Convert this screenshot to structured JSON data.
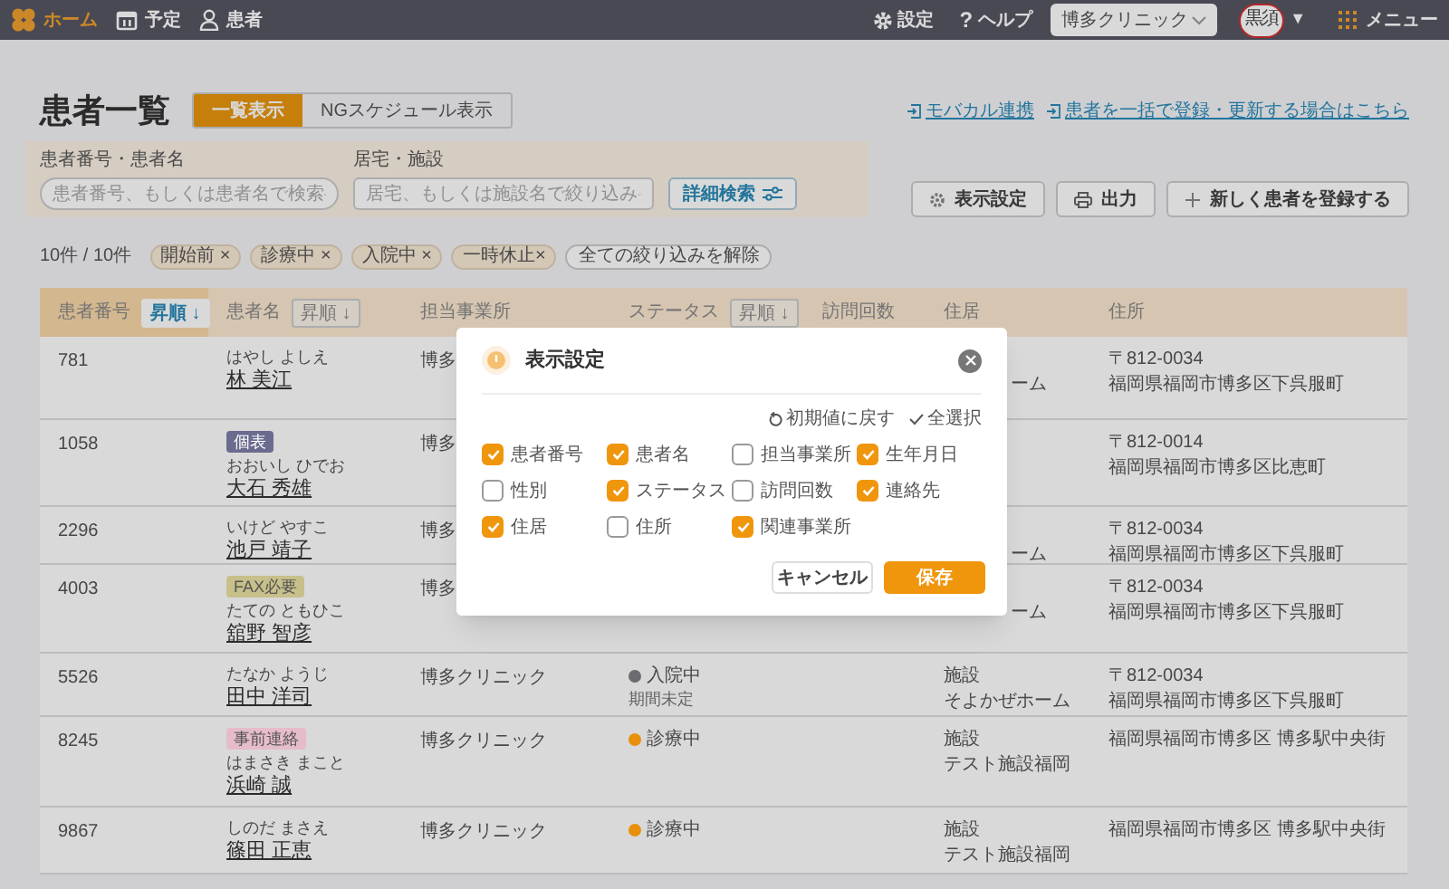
{
  "nav": {
    "items": [
      {
        "label": "ホーム",
        "kind": "home",
        "selected": true
      },
      {
        "label": "予定",
        "kind": "calendar",
        "selected": false
      },
      {
        "label": "患者",
        "kind": "person",
        "selected": false
      }
    ],
    "settings": "設定",
    "help_icon": "?",
    "help": "ヘルプ",
    "clinic_select": "博多クリニック",
    "avatar": "黒須",
    "avatar_caret": "▼",
    "menu": "メニュー"
  },
  "page": {
    "title": "患者一覧",
    "view_tabs": [
      {
        "label": "一覧表示",
        "selected": true
      },
      {
        "label": "NGスケジュール表示",
        "selected": false
      }
    ],
    "links": [
      "モバカル連携",
      "患者を一括で登録・更新する場合はこちら"
    ],
    "search": {
      "label": "患者番号・患者名",
      "placeholder": "患者番号、もしくは患者名で検索"
    },
    "facility": {
      "label": "居宅・施設",
      "placeholder": "居宅、もしくは施設名で絞り込み"
    },
    "advanced_search": "詳細検索",
    "actions": [
      {
        "label": "表示設定",
        "kind": "gear"
      },
      {
        "label": "出力",
        "kind": "printer"
      },
      {
        "label": "新しく患者を登録する",
        "kind": "plus"
      }
    ],
    "count": "10件 / 10件",
    "filters": [
      "開始前 ×",
      "診療中 ×",
      "入院中 ×",
      "一時休止×"
    ],
    "clear_filters": "全ての絞り込みを解除"
  },
  "table": {
    "columns": [
      {
        "label": "患者番号",
        "sort": "昇順 ↓",
        "selected": true
      },
      {
        "label": "患者名",
        "sort": "昇順 ↓",
        "selected": false
      },
      {
        "label": "担当事業所"
      },
      {
        "label": "ステータス",
        "sort": "昇順 ↓",
        "selected": false
      },
      {
        "label": "訪問回数"
      },
      {
        "label": "住居"
      },
      {
        "label": "住所"
      }
    ],
    "rows": [
      {
        "number": "781",
        "kana": "はやし よしえ",
        "name": "林 美江",
        "office": "博多",
        "residence": [
          "ーム"
        ],
        "covered": true,
        "address": [
          "〒812-0034",
          "福岡県福岡市博多区下呉服町"
        ]
      },
      {
        "number": "1058",
        "tag": {
          "text": "個表",
          "color": "#6b6b8f"
        },
        "kana": "おおいし ひでお",
        "name": "大石 秀雄",
        "office": "博多",
        "address": [
          "〒812-0014",
          "福岡県福岡市博多区比恵町"
        ]
      },
      {
        "number": "2296",
        "kana": "いけど やすこ",
        "name": "池戸 靖子",
        "office": "博多",
        "residence": [
          "ーム"
        ],
        "covered": true,
        "address": [
          "〒812-0034",
          "福岡県福岡市博多区下呉服町"
        ]
      },
      {
        "number": "4003",
        "tag": {
          "text": "FAX必要",
          "color": "#c8c08a"
        },
        "kana": "たての ともひこ",
        "name": "舘野 智彦",
        "office": "博多",
        "residence": [
          "ーム"
        ],
        "covered": true,
        "address": [
          "〒812-0034",
          "福岡県福岡市博多区下呉服町"
        ]
      },
      {
        "number": "5526",
        "kana": "たなか ようじ",
        "name": "田中 洋司",
        "office": "博多クリニック",
        "status": {
          "text": "入院中",
          "color": "#6b6b70",
          "note": "期間未定"
        },
        "residence": [
          "施設",
          "そよかぜホーム"
        ],
        "covered": false,
        "address": [
          "〒812-0034",
          "福岡県福岡市博多区下呉服町"
        ]
      },
      {
        "number": "8245",
        "tag": {
          "text": "事前連絡",
          "color": "#e6bccb"
        },
        "kana": "はまさき まこと",
        "name": "浜崎 誠",
        "office": "博多クリニック",
        "status": {
          "text": "診療中",
          "color": "#e8900c"
        },
        "residence": [
          "施設",
          "テスト施設福岡"
        ],
        "covered": false,
        "address": [
          "福岡県福岡市博多区 博多駅中央街"
        ]
      },
      {
        "number": "9867",
        "kana": "しのだ まさえ",
        "name": "篠田 正恵",
        "office": "博多クリニック",
        "status": {
          "text": "診療中",
          "color": "#e8900c"
        },
        "residence": [
          "施設",
          "テスト施設福岡"
        ],
        "covered": false,
        "address": [
          "福岡県福岡市博多区 博多駅中央街"
        ]
      }
    ]
  },
  "dialog": {
    "title": "表示設定",
    "reset": "初期値に戻す",
    "select_all": "全選択",
    "options": [
      {
        "label": "患者番号",
        "checked": true
      },
      {
        "label": "患者名",
        "checked": true
      },
      {
        "label": "担当事業所",
        "checked": false
      },
      {
        "label": "生年月日",
        "checked": true
      },
      {
        "label": "性別",
        "checked": false
      },
      {
        "label": "ステータス",
        "checked": true
      },
      {
        "label": "訪問回数",
        "checked": false
      },
      {
        "label": "連絡先",
        "checked": true
      },
      {
        "label": "住居",
        "checked": true
      },
      {
        "label": "住所",
        "checked": false
      },
      {
        "label": "関連事業所",
        "checked": true
      }
    ],
    "cancel": "キャンセル",
    "save": "保存"
  }
}
